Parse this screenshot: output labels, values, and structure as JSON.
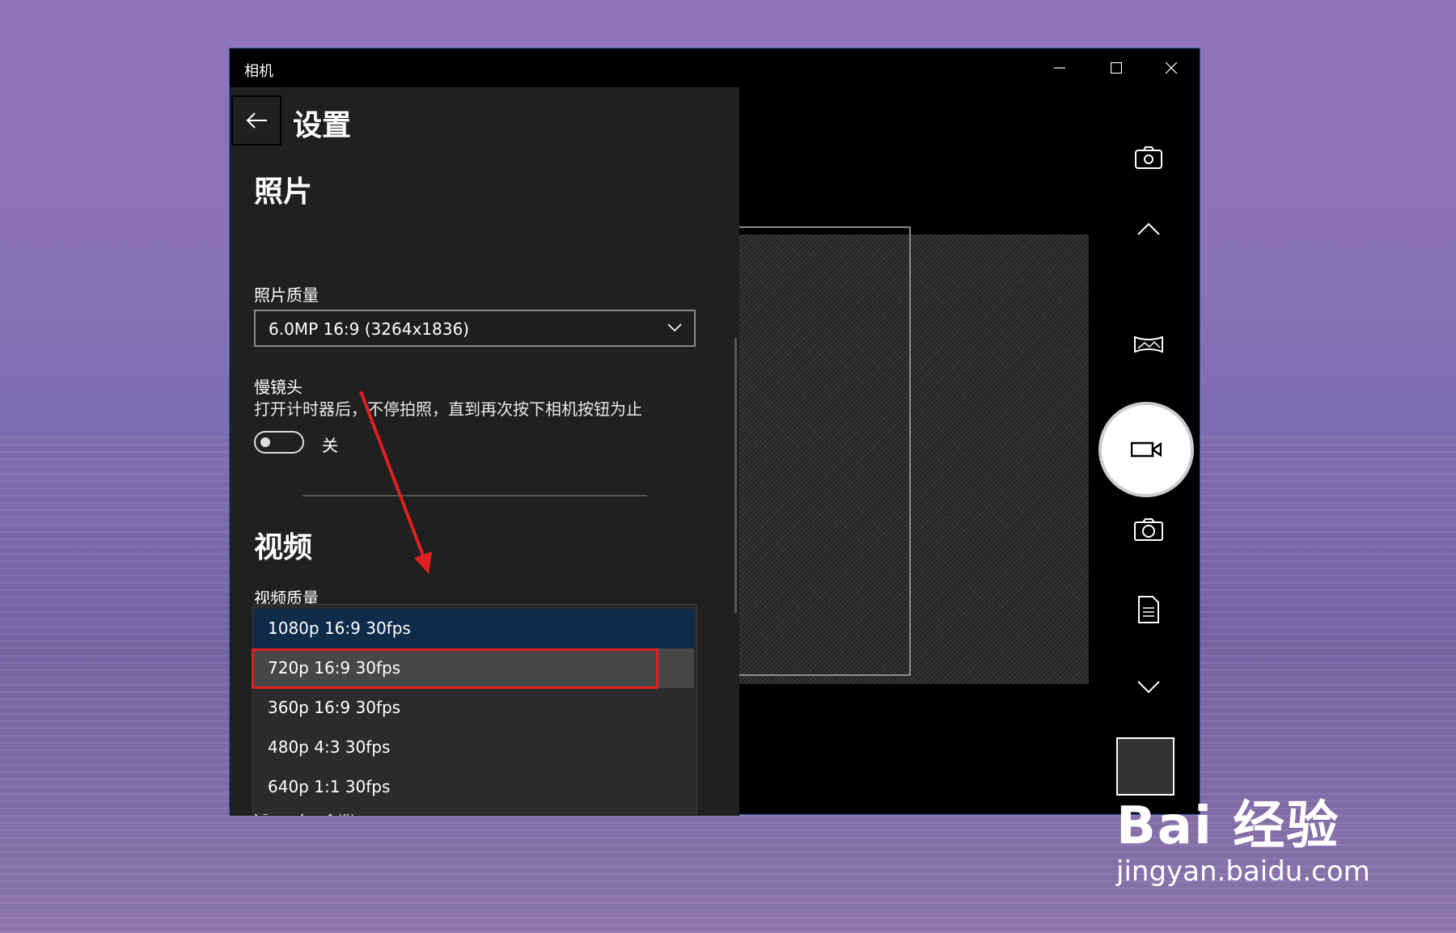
{
  "window": {
    "title": "相机"
  },
  "settings": {
    "header": "设置",
    "photo": {
      "heading": "照片",
      "quality_label": "照片质量",
      "quality_value": "6.0MP 16:9 (3264x1836)",
      "timelapse_label": "慢镜头",
      "timelapse_desc": "打开计时器后，不停拍照，直到再次按下相机按钮为止",
      "timelapse_toggle": "关"
    },
    "video": {
      "heading": "视频",
      "quality_label": "视频质量",
      "options": [
        "1080p 16:9 30fps",
        "720p 16:9 30fps",
        "360p 16:9 30fps",
        "480p 4:3 30fps",
        "640p 1:1 30fps"
      ],
      "selected": "1080p 16:9 30fps",
      "hovered": "720p 16:9 30fps",
      "partial_toggle_label": "关闭"
    }
  },
  "watermark": {
    "brand": "Bai 经验",
    "url": "jingyan.baidu.com"
  },
  "colors": {
    "accent_blue": "#0e2b4a",
    "highlight_red": "#e02020",
    "window_border": "#2a5fb0"
  }
}
